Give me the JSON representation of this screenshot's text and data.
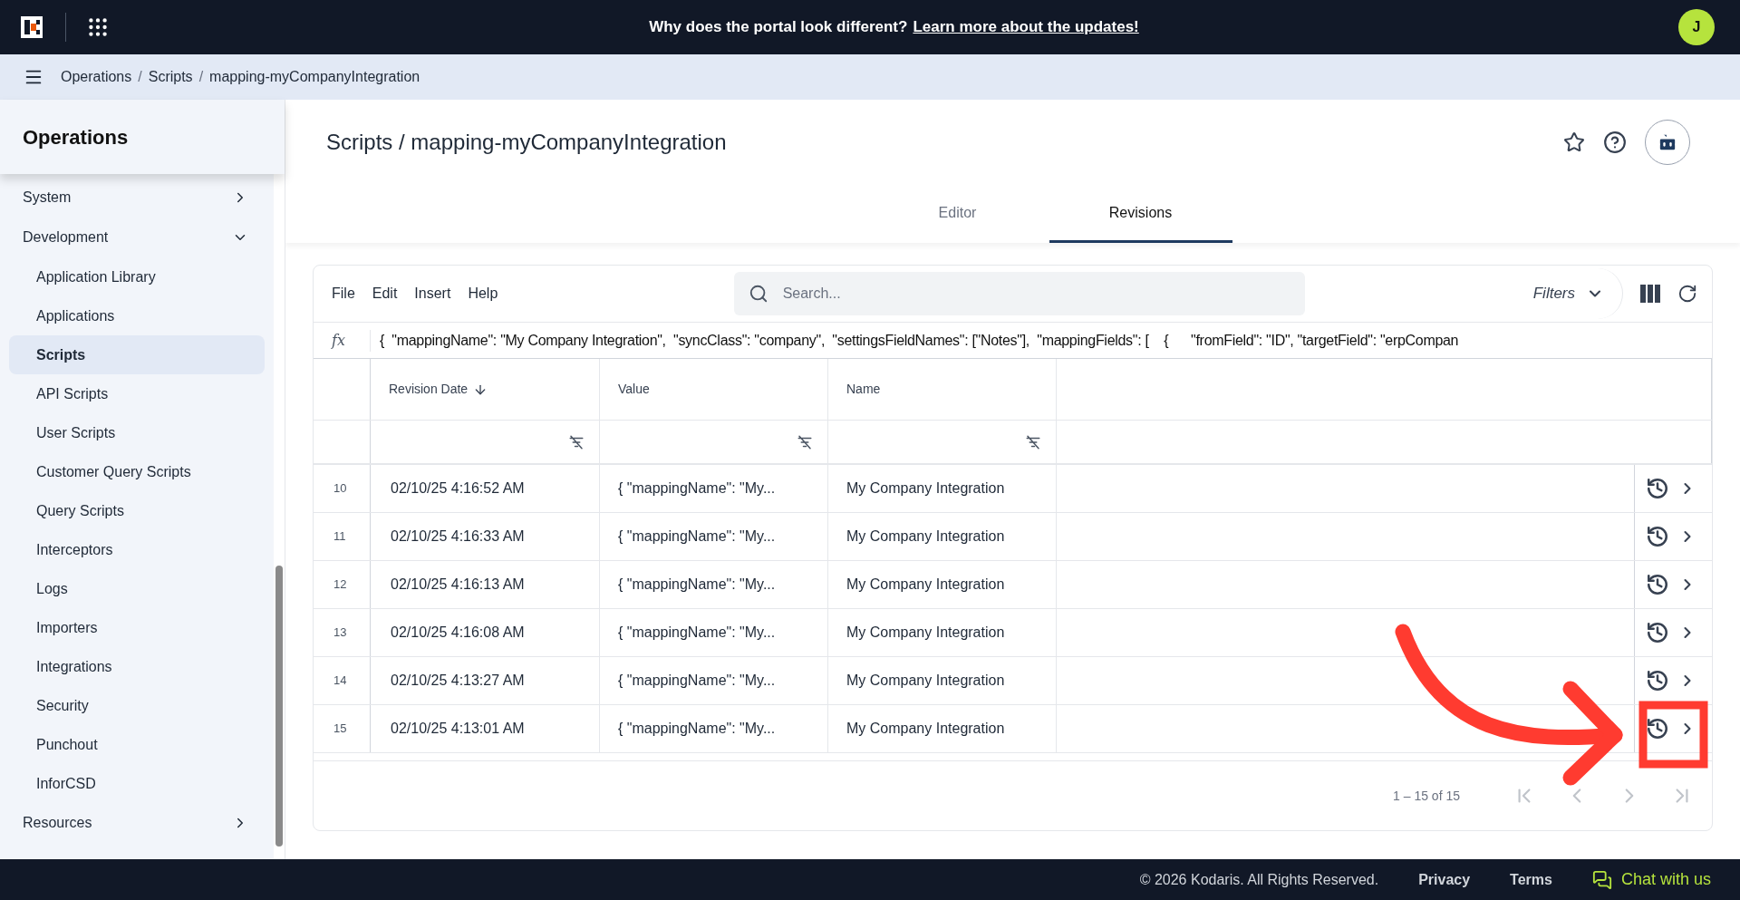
{
  "top_bar": {
    "banner_text": "Why does the portal look different?",
    "banner_link": "Learn more about the updates!",
    "avatar": "J"
  },
  "breadcrumb": {
    "separator": "/",
    "items": [
      "Operations",
      "Scripts",
      "mapping-myCompanyIntegration"
    ]
  },
  "sidebar": {
    "title": "Operations",
    "items": [
      {
        "label": "System",
        "expanded": false,
        "selected": false
      },
      {
        "label": "Development",
        "expanded": true,
        "selected": false,
        "children": [
          {
            "label": "Application Library",
            "selected": false
          },
          {
            "label": "Applications",
            "selected": false
          },
          {
            "label": "Scripts",
            "selected": true
          },
          {
            "label": "API Scripts",
            "selected": false
          },
          {
            "label": "User Scripts",
            "selected": false
          },
          {
            "label": "Customer Query Scripts",
            "selected": false
          },
          {
            "label": "Query Scripts",
            "selected": false
          },
          {
            "label": "Interceptors",
            "selected": false
          },
          {
            "label": "Logs",
            "selected": false
          },
          {
            "label": "Importers",
            "selected": false
          },
          {
            "label": "Integrations",
            "selected": false
          },
          {
            "label": "Security",
            "selected": false
          },
          {
            "label": "Punchout",
            "selected": false
          },
          {
            "label": "InforCSD",
            "selected": false
          }
        ]
      },
      {
        "label": "Resources",
        "expanded": false,
        "selected": false
      }
    ]
  },
  "page": {
    "title": "Scripts / mapping-myCompanyIntegration"
  },
  "tabs": [
    {
      "label": "Editor",
      "selected": false
    },
    {
      "label": "Revisions",
      "selected": true
    }
  ],
  "grid": {
    "menu": [
      "File",
      "Edit",
      "Insert",
      "Help"
    ],
    "search": {
      "placeholder": "Search..."
    },
    "filters": "Filters",
    "formula_label": "fx",
    "formula": "{  \"mappingName\": \"My Company Integration\",  \"syncClass\": \"company\",  \"settingsFieldNames\": [\"Notes\"],  \"mappingFields\": [    {      \"fromField\": \"ID\", \"targetField\": \"erpCompan",
    "columns": [
      {
        "label": "Revision Date",
        "sorted": true
      },
      {
        "label": "Value",
        "sorted": false
      },
      {
        "label": "Name",
        "sorted": false
      }
    ],
    "rows": [
      {
        "number": "10",
        "date": "02/10/25 4:16:52 AM",
        "value": "{ \"mappingName\": \"My...",
        "name": "My Company Integration"
      },
      {
        "number": "11",
        "date": "02/10/25 4:16:33 AM",
        "value": "{ \"mappingName\": \"My...",
        "name": "My Company Integration"
      },
      {
        "number": "12",
        "date": "02/10/25 4:16:13 AM",
        "value": "{ \"mappingName\": \"My...",
        "name": "My Company Integration"
      },
      {
        "number": "13",
        "date": "02/10/25 4:16:08 AM",
        "value": "{ \"mappingName\": \"My...",
        "name": "My Company Integration"
      },
      {
        "number": "14",
        "date": "02/10/25 4:13:27 AM",
        "value": "{ \"mappingName\": \"My...",
        "name": "My Company Integration"
      },
      {
        "number": "15",
        "date": "02/10/25 4:13:01 AM",
        "value": "{ \"mappingName\": \"My...",
        "name": "My Company Integration"
      }
    ],
    "pagination": "1 – 15 of 15"
  },
  "footer": {
    "copyright": "© 2026 Kodaris. All Rights Reserved.",
    "links": [
      "Privacy",
      "Terms"
    ],
    "chat": "Chat with us"
  }
}
